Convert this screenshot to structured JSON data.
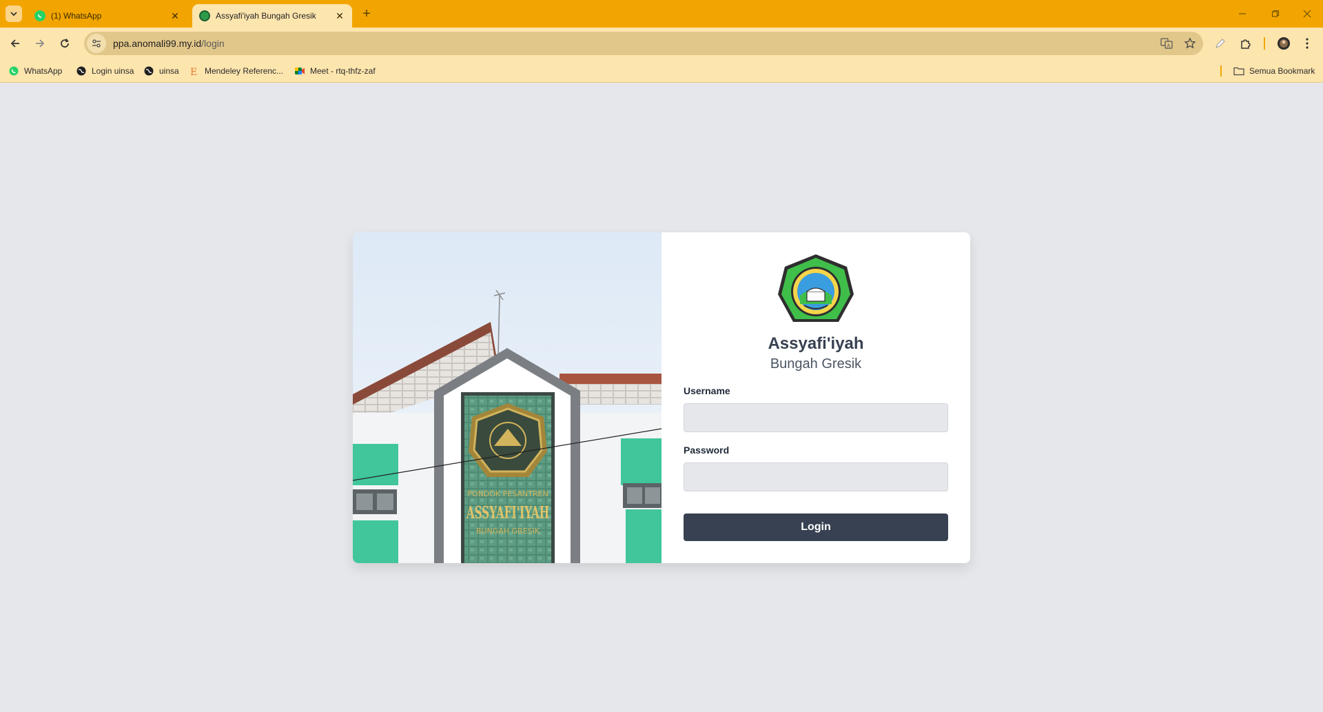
{
  "browser": {
    "tabs": [
      {
        "title": "(1) WhatsApp",
        "active": false
      },
      {
        "title": "Assyafi'iyah Bungah Gresik",
        "active": true
      }
    ],
    "url_host": "ppa.anomali99.my.id",
    "url_path": "/login",
    "bookmarks": [
      {
        "label": "WhatsApp",
        "icon": "whatsapp-icon"
      },
      {
        "label": "Login uinsa",
        "icon": "globe-icon"
      },
      {
        "label": "uinsa",
        "icon": "globe-icon"
      },
      {
        "label": "Mendeley Referenc...",
        "icon": "mendeley-icon"
      },
      {
        "label": "Meet - rtq-thfz-zaf",
        "icon": "meet-icon"
      }
    ],
    "all_bookmarks_label": "Semua Bookmark",
    "colors": {
      "frame": "#f2a500",
      "toolbar": "#fde5ae"
    }
  },
  "page": {
    "brand_name": "Assyafi'iyah",
    "brand_sub": "Bungah Gresik",
    "username_label": "Username",
    "username_value": "",
    "password_label": "Password",
    "password_value": "",
    "login_label": "Login",
    "photo_sign_line1": "PONDOK PESANTREN",
    "photo_sign_line2": "ASSYAFI'IYAH",
    "photo_sign_line3": "BUNGAH GRESIK",
    "colors": {
      "background": "#e5e7eb",
      "button": "#374151",
      "input": "#e5e7eb"
    }
  }
}
